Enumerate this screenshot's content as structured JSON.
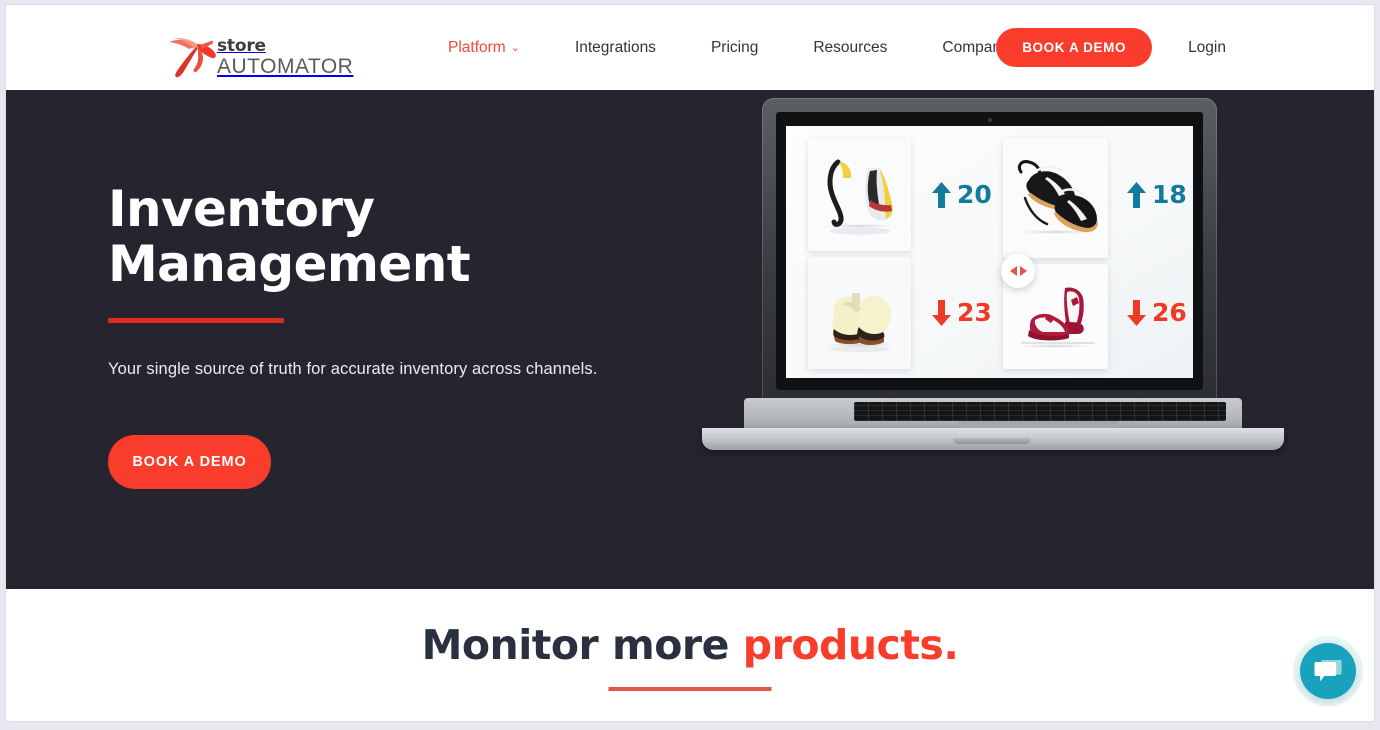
{
  "brand": {
    "logo_icon": "hummingbird-icon",
    "name_top": "store",
    "name_bottom": "AUTOMATOR"
  },
  "nav": {
    "items": [
      {
        "label": "Platform",
        "active": true,
        "has_dropdown": true,
        "chevron": "⌄"
      },
      {
        "label": "Integrations",
        "active": false,
        "has_dropdown": false
      },
      {
        "label": "Pricing",
        "active": false,
        "has_dropdown": false
      },
      {
        "label": "Resources",
        "active": false,
        "has_dropdown": false
      },
      {
        "label": "Company",
        "active": false,
        "has_dropdown": false
      }
    ],
    "cta_label": "BOOK A DEMO",
    "login_label": "Login"
  },
  "hero": {
    "title_line1": "Inventory",
    "title_line2": "Management",
    "subtitle": "Your single source of truth for accurate inventory across channels.",
    "cta_label": "BOOK A DEMO",
    "background_color": "#26242e",
    "accent_color": "#e02b21"
  },
  "laptop": {
    "carousel_icon": "carousel-prev-next-icon",
    "tiles": [
      {
        "position": "top-left",
        "product": "white-yellow-sneakers-thumbnail"
      },
      {
        "position": "bottom-left",
        "product": "cream-sneakers-thumbnail"
      },
      {
        "position": "top-right",
        "product": "black-gum-sneakers-thumbnail"
      },
      {
        "position": "bottom-right",
        "product": "red-white-high-top-thumbnail"
      }
    ],
    "deltas": [
      {
        "direction": "up",
        "value": "20",
        "icon": "arrow-up-icon",
        "color": "#127a9c"
      },
      {
        "direction": "up",
        "value": "18",
        "icon": "arrow-up-icon",
        "color": "#127a9c"
      },
      {
        "direction": "down",
        "value": "23",
        "icon": "arrow-down-icon",
        "color": "#ef3b26"
      },
      {
        "direction": "down",
        "value": "26",
        "icon": "arrow-down-icon",
        "color": "#ef3b26"
      }
    ]
  },
  "lower_section": {
    "heading_plain": "Monitor more ",
    "heading_accent": "products.",
    "accent_color": "#fa3c2d"
  },
  "chat": {
    "icon": "chat-bubble-icon",
    "color": "#19a2bd"
  }
}
